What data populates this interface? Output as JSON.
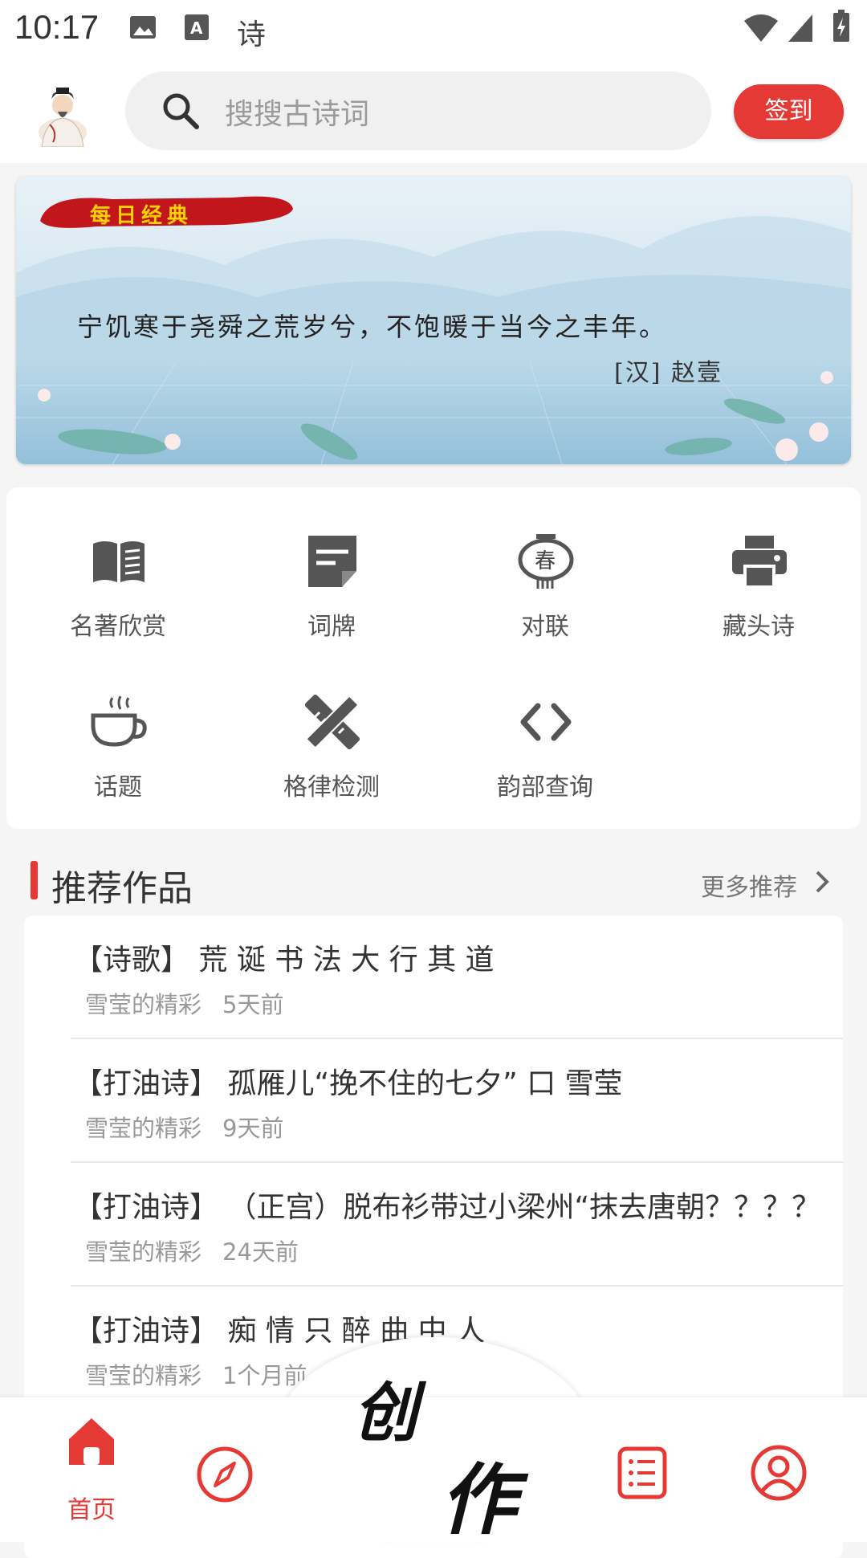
{
  "status_bar": {
    "time": "10:17",
    "notification_char": "诗",
    "icons": [
      "image-icon",
      "font-download-icon",
      "wifi-icon",
      "signal-icon",
      "battery-charging-icon"
    ]
  },
  "header": {
    "search_placeholder": "搜搜古诗词",
    "signin_label": "签到"
  },
  "banner": {
    "tag": "每日经典",
    "quote": "宁饥寒于尧舜之荒岁兮，不饱暖于当今之丰年。",
    "author": "[汉] 赵壹"
  },
  "features": [
    {
      "label": "名著欣赏",
      "icon": "book-icon"
    },
    {
      "label": "词牌",
      "icon": "note-icon"
    },
    {
      "label": "对联",
      "icon": "couplet-icon"
    },
    {
      "label": "藏头诗",
      "icon": "printer-icon"
    },
    {
      "label": "话题",
      "icon": "coffee-icon"
    },
    {
      "label": "格律检测",
      "icon": "tools-icon"
    },
    {
      "label": "韵部查询",
      "icon": "code-icon"
    }
  ],
  "recommend": {
    "title": "推荐作品",
    "more": "更多推荐",
    "items": [
      {
        "title": "【诗歌】 荒 诞 书 法 大 行 其 道",
        "author": "雪莹的精彩",
        "time": "5天前"
      },
      {
        "title": "【打油诗】 孤雁儿“挽不住的七夕”  口 雪莹",
        "author": "雪莹的精彩",
        "time": "9天前"
      },
      {
        "title": "【打油诗】 （正宫）脱布衫带过小梁州“抹去唐朝？？？？",
        "author": "雪莹的精彩",
        "time": "24天前"
      },
      {
        "title": "【打油诗】 痴 情 只 醉 曲 中 人",
        "author": "雪莹的精彩",
        "time": "1个月前"
      }
    ]
  },
  "bottom_nav": {
    "home_label": "首页",
    "create_chars": [
      "创",
      "作"
    ],
    "accent": "#e53935"
  }
}
